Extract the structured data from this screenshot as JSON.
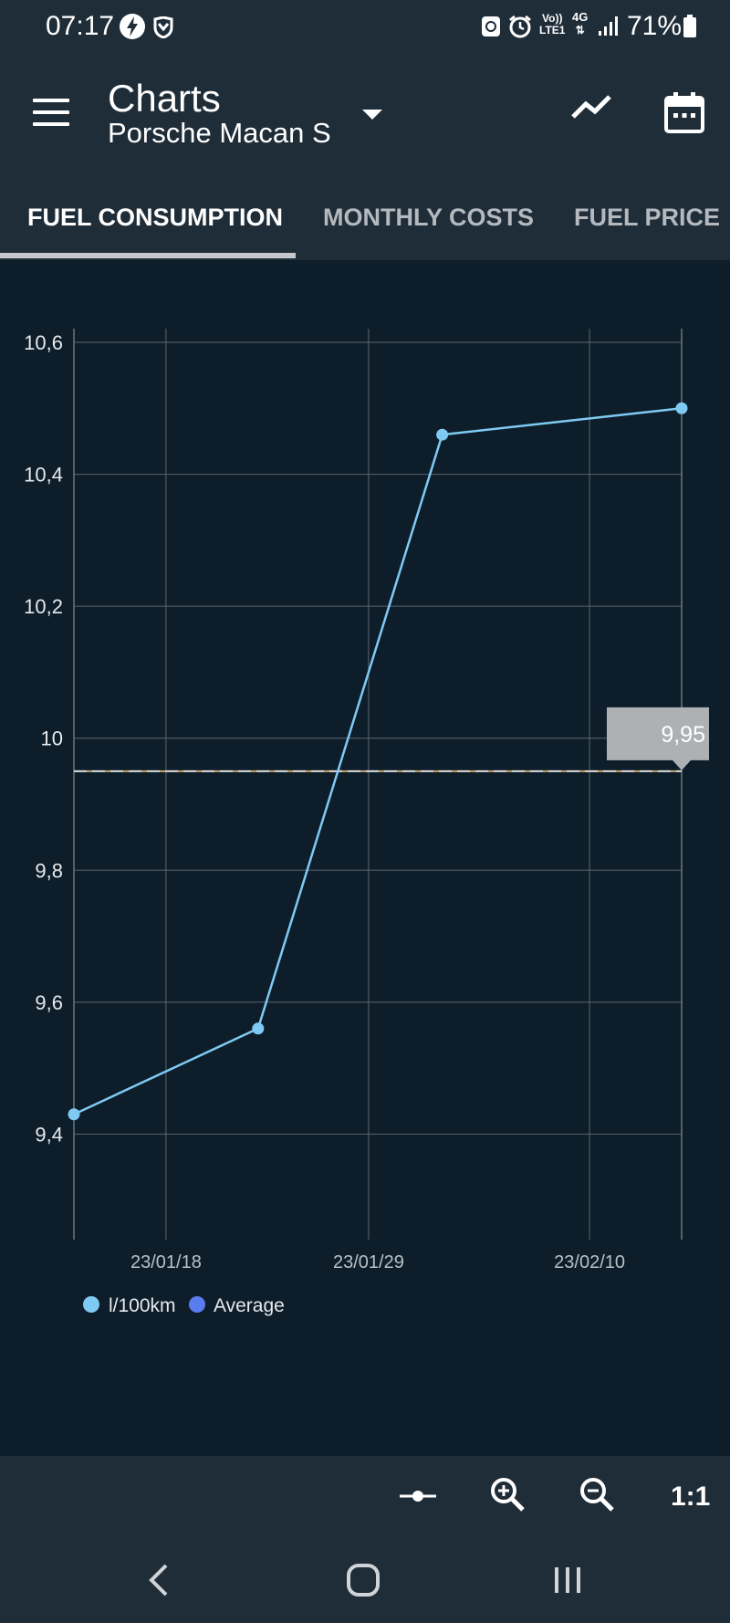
{
  "status_bar": {
    "time": "07:17",
    "network_top": "Vo))",
    "network_bottom": "LTE1",
    "signal_type": "4G",
    "battery": "71%",
    "icons": [
      "bolt-icon",
      "shield-icon",
      "recycle-icon",
      "alarm-icon",
      "volte-icon",
      "signal-icon",
      "battery-icon"
    ]
  },
  "app_bar": {
    "title": "Charts",
    "subtitle": "Porsche Macan S",
    "icons": [
      "menu-icon",
      "dropdown-arrow-icon",
      "trend-icon",
      "calendar-icon"
    ]
  },
  "tabs": [
    {
      "label": "FUEL CONSUMPTION",
      "active": true
    },
    {
      "label": "MONTHLY COSTS",
      "active": false
    },
    {
      "label": "FUEL PRICE",
      "active": false
    }
  ],
  "chart_data": {
    "type": "line",
    "title": "",
    "xlabel": "",
    "ylabel": "",
    "ylim": [
      9.33,
      10.6
    ],
    "yticks": [
      "10,6",
      "10,4",
      "10,2",
      "10",
      "9,8",
      "9,6",
      "9,4"
    ],
    "ytick_values": [
      10.6,
      10.4,
      10.2,
      10.0,
      9.8,
      9.6,
      9.4
    ],
    "xlim": [
      "2023-01-13",
      "2023-02-15"
    ],
    "xticks": [
      "23/01/18",
      "23/01/29",
      "23/02/10"
    ],
    "xtick_dates": [
      "2023-01-18",
      "2023-01-29",
      "2023-02-10"
    ],
    "grid": true,
    "series": [
      {
        "name": "l/100km",
        "color": "#7fcaf3",
        "x": [
          "2023-01-13",
          "2023-01-23",
          "2023-02-02",
          "2023-02-15"
        ],
        "values": [
          9.43,
          9.56,
          10.46,
          10.5
        ]
      }
    ],
    "average": {
      "name": "Average",
      "value": 9.95,
      "label": "9,95",
      "color": "#5b7bf0"
    },
    "legend": "bottom-left"
  },
  "toolbar": {
    "icons": [
      "zoom-reset-icon",
      "zoom-in-icon",
      "zoom-out-icon"
    ],
    "ratio_label": "1:1"
  },
  "nav_bar": {
    "icons": [
      "back-icon",
      "home-icon",
      "recents-icon"
    ]
  }
}
